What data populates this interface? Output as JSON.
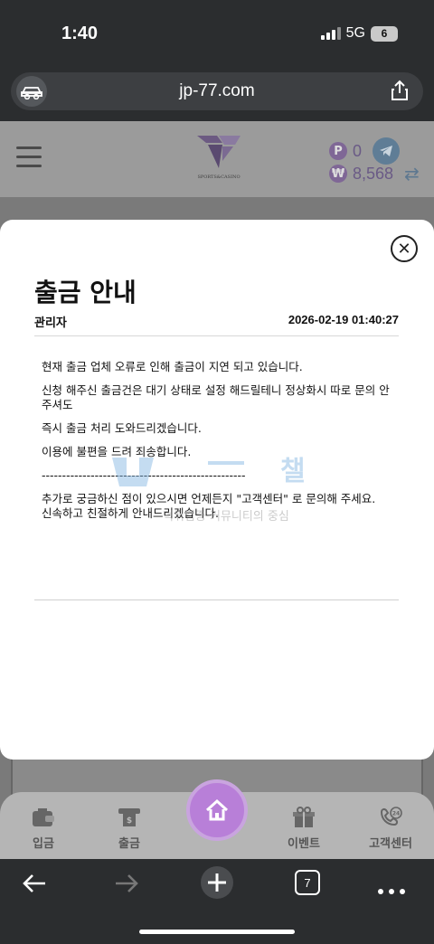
{
  "status": {
    "time": "1:40",
    "network": "5G",
    "battery": "6"
  },
  "browser": {
    "url": "jp-77.com",
    "tab_count": "7"
  },
  "site": {
    "logo_sub": "SPORTS&CASINO",
    "points_symbol": "P",
    "points": "0",
    "currency_symbol": "₩",
    "balance": "8,568"
  },
  "modal": {
    "title": "출금 안내",
    "author": "관리자",
    "datetime": "2026-02-19 01:40:27",
    "paragraphs": [
      "현재 출금 업체 오류로 인해 출금이 지연 되고 있습니다.",
      "신청 해주신 출금건은 대기 상태로 설정 해드릴테니 정상화시 따로 문의 안주셔도",
      "즉시 출금 처리 도와드리겠습니다.",
      "이용에 불편을 드려 죄송합니다.",
      "--------------------------------------------------",
      "추가로 궁금하신 점이 있으시면 언제든지 \"고객센터\" 로 문의해 주세요.\n신속하고 친절하게 안내드리겠습니다."
    ]
  },
  "watermark": {
    "word": "챌",
    "sub": "먹튀검증 커뮤니티의 중심"
  },
  "tabbar": {
    "deposit": "입금",
    "withdraw": "출금",
    "event": "이벤트",
    "support": "고객센터",
    "support_badge": "24"
  },
  "colors": {
    "accent": "#b87fd8",
    "modal_bg": "#ffffff",
    "chrome": "#2b2d2f"
  }
}
